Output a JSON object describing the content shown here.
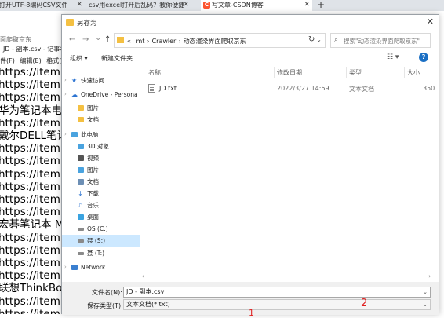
{
  "browser": {
    "tabs": [
      {
        "label": "打开UTF-8编码CSV文件"
      },
      {
        "label": "csv用excel打开后乱码？教你便捷"
      },
      {
        "label": "写文章-CSDN博客"
      }
    ],
    "csdn_logo": "C",
    "new_tab": "+"
  },
  "notepad": {
    "search_text": "面爬取京东",
    "title": "JD - 副本.csv - 记事本",
    "menu": [
      "件(F)",
      "编辑(E)",
      "格式(O)"
    ],
    "lines": [
      "https://item.jd",
      "https://item.jd",
      "https://item.jd",
      "华为笔记本电脑",
      "https://item.jd",
      "戴尔DELL笔记本",
      "https://item.jd",
      "https://item.jd",
      "https://item.jd",
      "https://item.jd",
      "https://item.jd",
      "https://item.jd",
      "宏碁笔记本 Ma",
      "https://item.jd",
      "https://item.jd",
      "https://item.jd",
      "https://item.jd",
      "联想ThinkBook",
      "https://item.jd",
      "https://item.jd"
    ]
  },
  "dialog": {
    "title": "另存为",
    "close": "✕",
    "nav": {
      "back": "←",
      "forward": "→",
      "recent": "⌄",
      "up": "↑",
      "refresh": "↻"
    },
    "address": {
      "prefix": "«",
      "crumbs": [
        "mt",
        "Crawler",
        "动态渲染界面爬取京东"
      ],
      "dropdown": "⌄"
    },
    "search_placeholder": "搜索\"动态渲染界面爬取京东\"",
    "toolbar": {
      "organize": "组织 ▾",
      "new_folder": "新建文件夹",
      "view": "☷ ▾",
      "help": "?"
    },
    "sidebar": [
      {
        "label": "快速访问",
        "icon": "star-icon"
      },
      {
        "label": "OneDrive - Persona",
        "icon": "cloud-icon"
      },
      {
        "label": "图片",
        "icon": "folder-icon"
      },
      {
        "label": "文档",
        "icon": "folder-icon"
      },
      {
        "label": "此电脑",
        "icon": "computer-icon"
      },
      {
        "label": "3D 对象",
        "icon": "cube-icon"
      },
      {
        "label": "视频",
        "icon": "video-icon"
      },
      {
        "label": "图片",
        "icon": "picture-icon"
      },
      {
        "label": "文档",
        "icon": "document-icon"
      },
      {
        "label": "下载",
        "icon": "download-icon"
      },
      {
        "label": "音乐",
        "icon": "music-icon"
      },
      {
        "label": "桌面",
        "icon": "desktop-icon"
      },
      {
        "label": "OS (C:)",
        "icon": "drive-icon"
      },
      {
        "label": "聂 (S:)",
        "icon": "drive-icon"
      },
      {
        "label": "聂 (T:)",
        "icon": "drive-icon"
      },
      {
        "label": "Network",
        "icon": "network-icon"
      }
    ],
    "columns": [
      "名称",
      "修改日期",
      "类型",
      "大小"
    ],
    "files": [
      {
        "name": "JD.txt",
        "modified": "2022/3/27 14:59",
        "type": "文本文档",
        "size": "350"
      }
    ],
    "filename_label": "文件名(N):",
    "filename_value": "JD - 副本.csv",
    "filetype_label": "保存类型(T):",
    "filetype_value": "文本文档(*.txt)",
    "annotation_2": "2",
    "annotation_1": "1"
  },
  "colors": {
    "accent": "#1a6fc4",
    "selection": "#cce8ff",
    "annotation": "#e02020",
    "folder": "#f4c042"
  }
}
